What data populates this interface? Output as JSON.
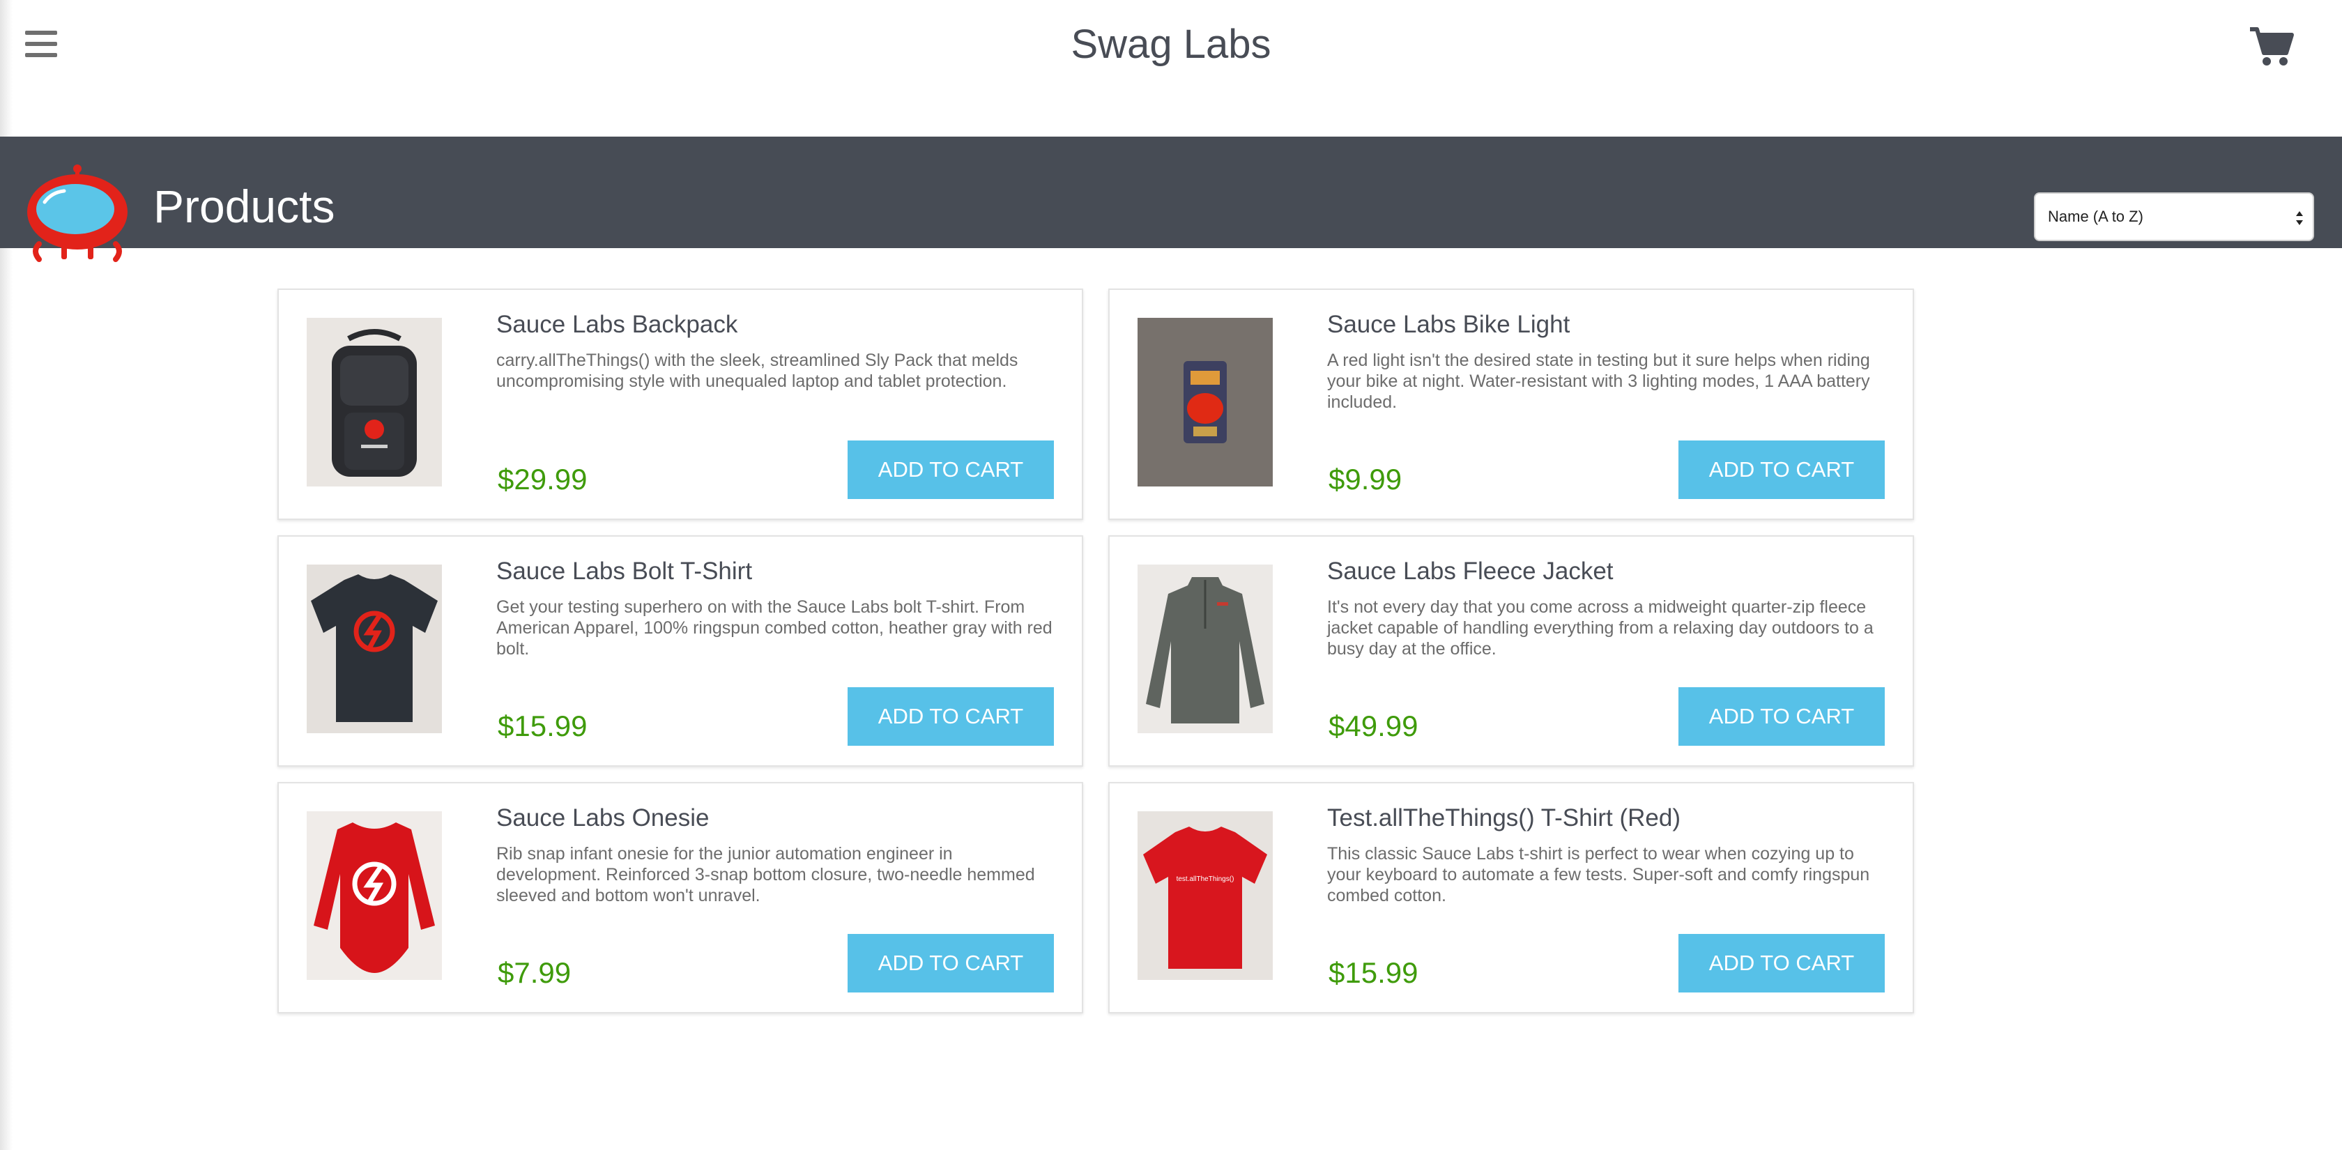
{
  "app": {
    "title": "Swag Labs"
  },
  "header": {
    "menu_icon": "hamburger-menu-icon",
    "cart_icon": "shopping-cart-icon"
  },
  "secondary_header": {
    "title": "Products",
    "sort": {
      "selected": "Name (A to Z)"
    }
  },
  "colors": {
    "header_bar": "#474c55",
    "button": "#57c1e8",
    "price": "#3f9b0b",
    "logo_red": "#e2231a",
    "logo_blue": "#5bc5e8"
  },
  "products": [
    {
      "name": "Sauce Labs Backpack",
      "description": "carry.allTheThings() with the sleek, streamlined Sly Pack that melds uncompromising style with unequaled laptop and tablet protection.",
      "price": "$29.99",
      "button": "ADD TO CART",
      "image": "backpack-image"
    },
    {
      "name": "Sauce Labs Bike Light",
      "description": "A red light isn't the desired state in testing but it sure helps when riding your bike at night. Water-resistant with 3 lighting modes, 1 AAA battery included.",
      "price": "$9.99",
      "button": "ADD TO CART",
      "image": "bike-light-image"
    },
    {
      "name": "Sauce Labs Bolt T-Shirt",
      "description": "Get your testing superhero on with the Sauce Labs bolt T-shirt. From American Apparel, 100% ringspun combed cotton, heather gray with red bolt.",
      "price": "$15.99",
      "button": "ADD TO CART",
      "image": "bolt-tshirt-image"
    },
    {
      "name": "Sauce Labs Fleece Jacket",
      "description": "It's not every day that you come across a midweight quarter-zip fleece jacket capable of handling everything from a relaxing day outdoors to a busy day at the office.",
      "price": "$49.99",
      "button": "ADD TO CART",
      "image": "fleece-jacket-image"
    },
    {
      "name": "Sauce Labs Onesie",
      "description": "Rib snap infant onesie for the junior automation engineer in development. Reinforced 3-snap bottom closure, two-needle hemmed sleeved and bottom won't unravel.",
      "price": "$7.99",
      "button": "ADD TO CART",
      "image": "onesie-image"
    },
    {
      "name": "Test.allTheThings() T-Shirt (Red)",
      "description": "This classic Sauce Labs t-shirt is perfect to wear when cozying up to your keyboard to automate a few tests. Super-soft and comfy ringspun combed cotton.",
      "price": "$15.99",
      "button": "ADD TO CART",
      "image": "red-tshirt-image",
      "image_text": "test.allTheThings()"
    }
  ]
}
